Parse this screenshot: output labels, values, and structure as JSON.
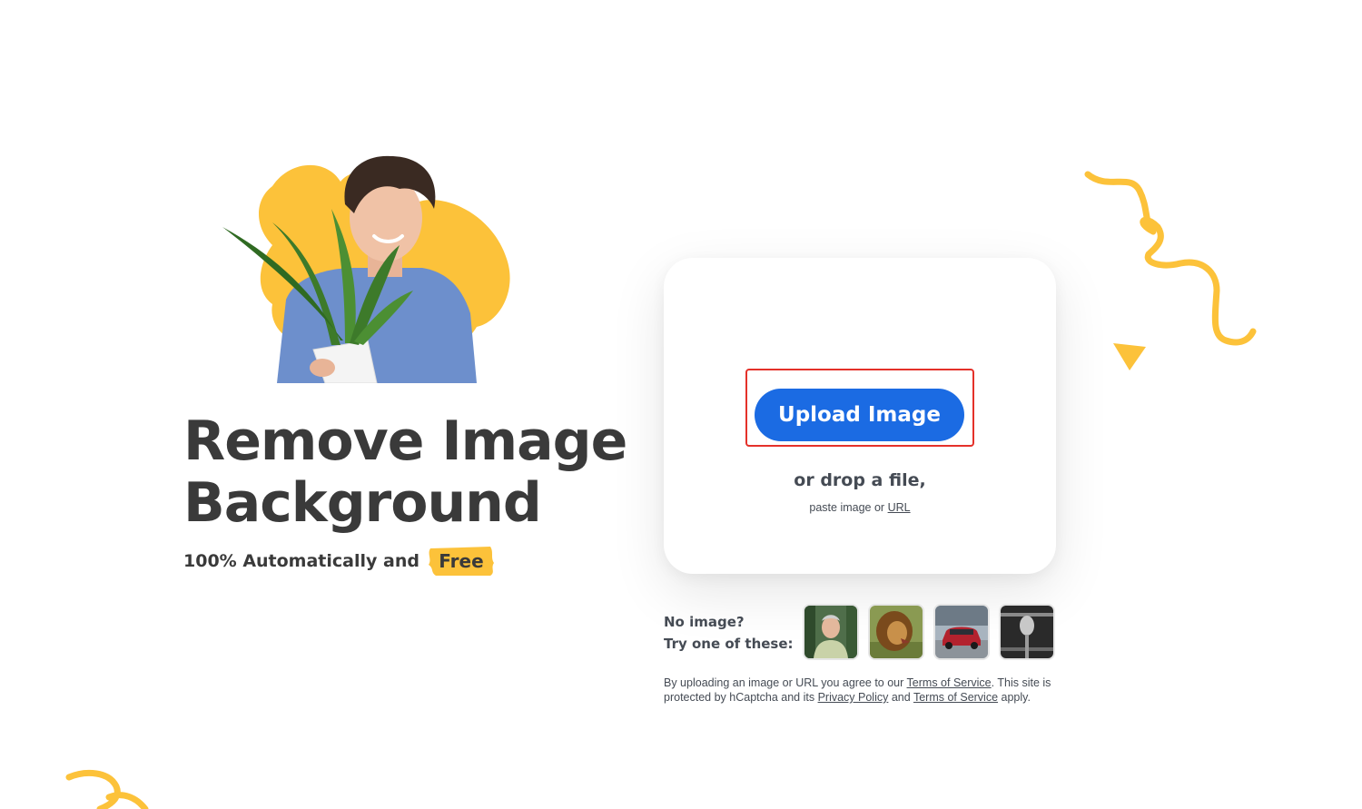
{
  "hero": {
    "title_line1": "Remove Image",
    "title_line2": "Background",
    "tagline": "100% Automatically and",
    "free_badge": "Free"
  },
  "upload": {
    "button_label": "Upload Image",
    "drop_text": "or drop a file,",
    "paste_text": "paste image or",
    "url_link": "URL"
  },
  "samples": {
    "label_line1": "No image?",
    "label_line2": "Try one of these:",
    "items": [
      {
        "name": "sample-person",
        "icon": "person-photo"
      },
      {
        "name": "sample-lion",
        "icon": "lion-photo"
      },
      {
        "name": "sample-car",
        "icon": "car-photo"
      },
      {
        "name": "sample-microphone",
        "icon": "microphone-photo"
      }
    ]
  },
  "legal": {
    "part1": "By uploading an image or URL you agree to our",
    "terms_link_1": "Terms of Service",
    "part2": ". This site is protected by hCaptcha and its",
    "privacy_link": "Privacy Policy",
    "part3": "and",
    "terms_link_2": "Terms of Service",
    "part4": "apply."
  },
  "colors": {
    "accent_yellow": "#fcc23a",
    "primary_blue": "#1b6be3",
    "highlight_red": "#e4312a",
    "text_dark": "#3a3a3a"
  }
}
